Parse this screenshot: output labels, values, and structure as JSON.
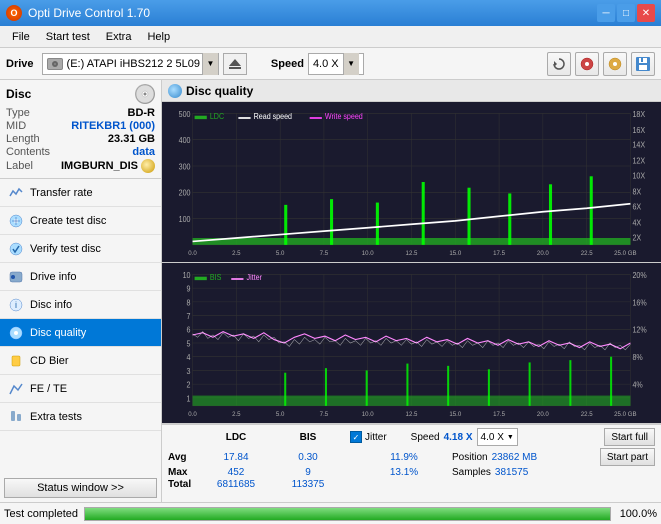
{
  "window": {
    "title": "Opti Drive Control 1.70",
    "min_btn": "─",
    "max_btn": "□",
    "close_btn": "✕"
  },
  "menu": {
    "items": [
      "File",
      "Start test",
      "Extra",
      "Help"
    ]
  },
  "toolbar": {
    "drive_label": "Drive",
    "drive_text": "(E:)  ATAPI iHBS212  2 5L09",
    "speed_label": "Speed",
    "speed_value": "4.0 X"
  },
  "disc": {
    "label": "Disc",
    "type_label": "Type",
    "type_value": "BD-R",
    "mid_label": "MID",
    "mid_value": "RITEKBR1 (000)",
    "length_label": "Length",
    "length_value": "23.31 GB",
    "contents_label": "Contents",
    "contents_value": "data",
    "disc_label_label": "Label",
    "disc_label_value": "IMGBURN_DIS"
  },
  "nav": {
    "items": [
      {
        "id": "transfer-rate",
        "label": "Transfer rate",
        "icon": "📊"
      },
      {
        "id": "create-test-disc",
        "label": "Create test disc",
        "icon": "💿"
      },
      {
        "id": "verify-test-disc",
        "label": "Verify test disc",
        "icon": "✔"
      },
      {
        "id": "drive-info",
        "label": "Drive info",
        "icon": "ℹ"
      },
      {
        "id": "disc-info",
        "label": "Disc info",
        "icon": "📋"
      },
      {
        "id": "disc-quality",
        "label": "Disc quality",
        "icon": "⭐",
        "active": true
      },
      {
        "id": "cd-bier",
        "label": "CD Bier",
        "icon": "🍺"
      },
      {
        "id": "fe-te",
        "label": "FE / TE",
        "icon": "📈"
      },
      {
        "id": "extra-tests",
        "label": "Extra tests",
        "icon": "🔬"
      }
    ]
  },
  "status_window_btn": "Status window >>",
  "disc_quality": {
    "title": "Disc quality"
  },
  "legend_upper": {
    "ldc_label": "LDC",
    "read_label": "Read speed",
    "write_label": "Write speed"
  },
  "legend_lower": {
    "bis_label": "BIS",
    "jitter_label": "Jitter"
  },
  "chart_upper": {
    "y_max": 500,
    "y_axis": [
      500,
      400,
      300,
      200,
      100
    ],
    "y_axis_right": [
      "18X",
      "16X",
      "14X",
      "12X",
      "10X",
      "8X",
      "6X",
      "4X",
      "2X"
    ],
    "x_axis": [
      "0.0",
      "2.5",
      "5.0",
      "7.5",
      "10.0",
      "12.5",
      "15.0",
      "17.5",
      "20.0",
      "22.5",
      "25.0 GB"
    ]
  },
  "chart_lower": {
    "y_max": 10,
    "y_axis": [
      10,
      9,
      8,
      7,
      6,
      5,
      4,
      3,
      2,
      1
    ],
    "y_axis_right": [
      "20%",
      "16%",
      "12%",
      "8%",
      "4%"
    ],
    "x_axis": [
      "0.0",
      "2.5",
      "5.0",
      "7.5",
      "10.0",
      "12.5",
      "15.0",
      "17.5",
      "20.0",
      "22.5",
      "25.0 GB"
    ]
  },
  "stats": {
    "columns": [
      "LDC",
      "BIS"
    ],
    "jitter_label": "Jitter",
    "speed_label": "Speed",
    "position_label": "Position",
    "samples_label": "Samples",
    "avg_label": "Avg",
    "max_label": "Max",
    "total_label": "Total",
    "ldc_avg": "17.84",
    "ldc_max": "452",
    "ldc_total": "6811685",
    "bis_avg": "0.30",
    "bis_max": "9",
    "bis_total": "113375",
    "jitter_avg": "11.9%",
    "jitter_max": "13.1%",
    "speed_value": "4.18 X",
    "speed_select": "4.0 X",
    "position_value": "23862 MB",
    "samples_value": "381575",
    "start_full": "Start full",
    "start_part": "Start part"
  },
  "status": {
    "text": "Test completed",
    "progress": 100,
    "progress_text": "100.0%"
  }
}
